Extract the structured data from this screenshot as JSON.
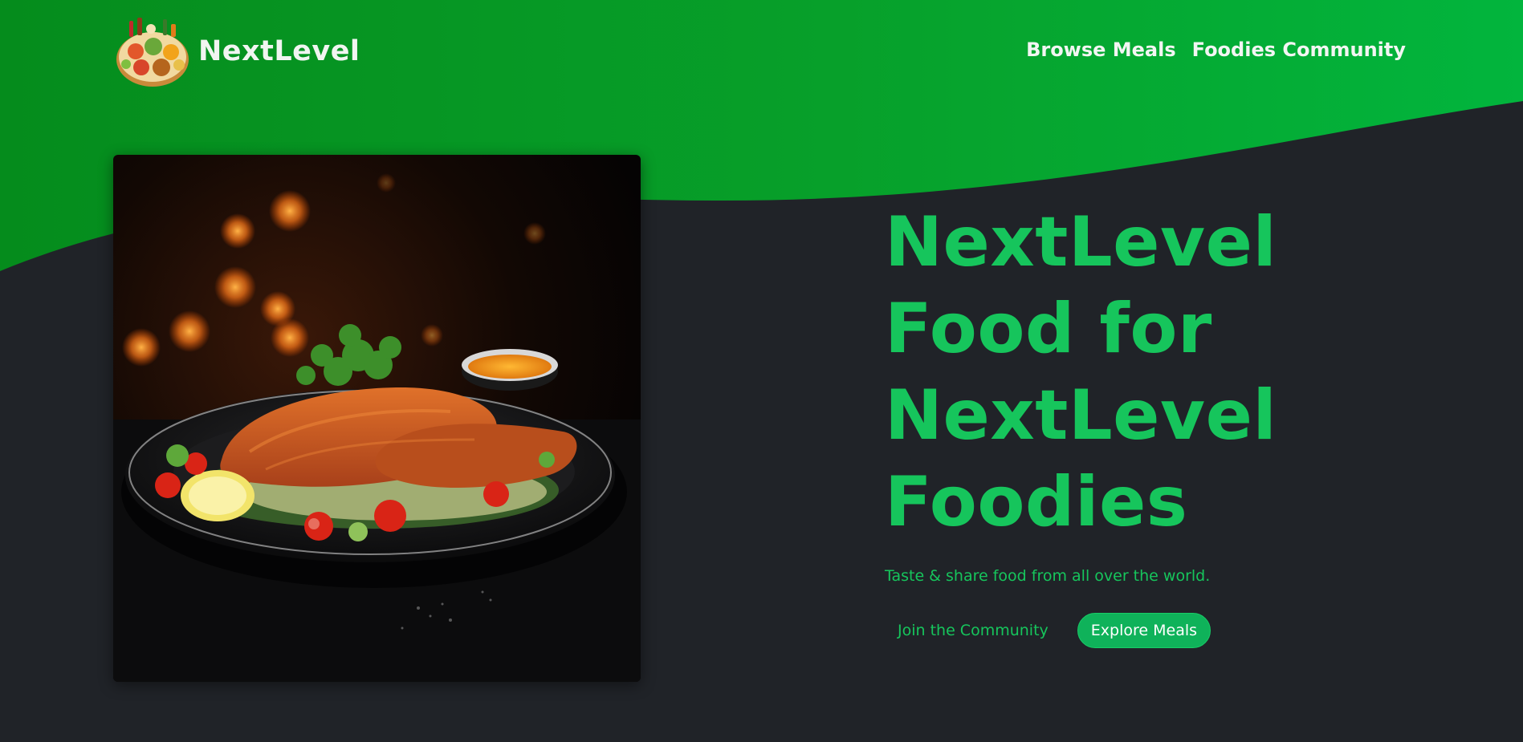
{
  "header": {
    "brand_name": "NextLevel",
    "logo_icon": "food-platter-logo-icon",
    "nav": [
      {
        "label": "Browse Meals"
      },
      {
        "label": "Foodies Community"
      }
    ]
  },
  "hero": {
    "image_subject": "schnitzel-plate",
    "title": "NextLevel Food for NextLevel Foodies",
    "tagline": "Taste & share food from all over the world.",
    "join_link_label": "Join the Community",
    "explore_button_label": "Explore Meals"
  },
  "colors": {
    "header_green_start": "#058c1c",
    "header_green_end": "#02b53d",
    "accent_green": "#16c55c",
    "button_green": "#0fb25a",
    "background_dark": "#202328"
  }
}
